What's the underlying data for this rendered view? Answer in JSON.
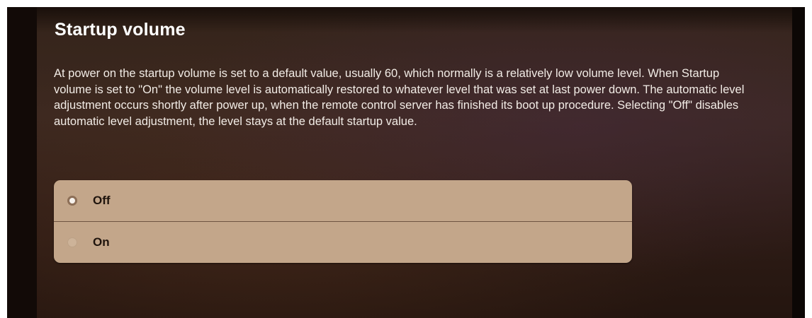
{
  "section": {
    "title": "Startup volume",
    "description": "At power on the startup volume is set to a default value, usually 60, which normally is a relatively low volume level. When Startup volume is set to \"On\" the volume level is automatically restored to whatever level that was set at last power down. The automatic level adjustment occurs shortly after power up, when the remote control server has finished its boot up procedure. Selecting \"Off\" disables automatic level adjustment, the level stays at the default startup value."
  },
  "options": [
    {
      "label": "Off",
      "selected": true
    },
    {
      "label": "On",
      "selected": false
    }
  ],
  "colors": {
    "background": "#3b2820",
    "options_panel": "#c3a68a",
    "title_text": "#ffffff",
    "option_text": "#1f140d"
  }
}
